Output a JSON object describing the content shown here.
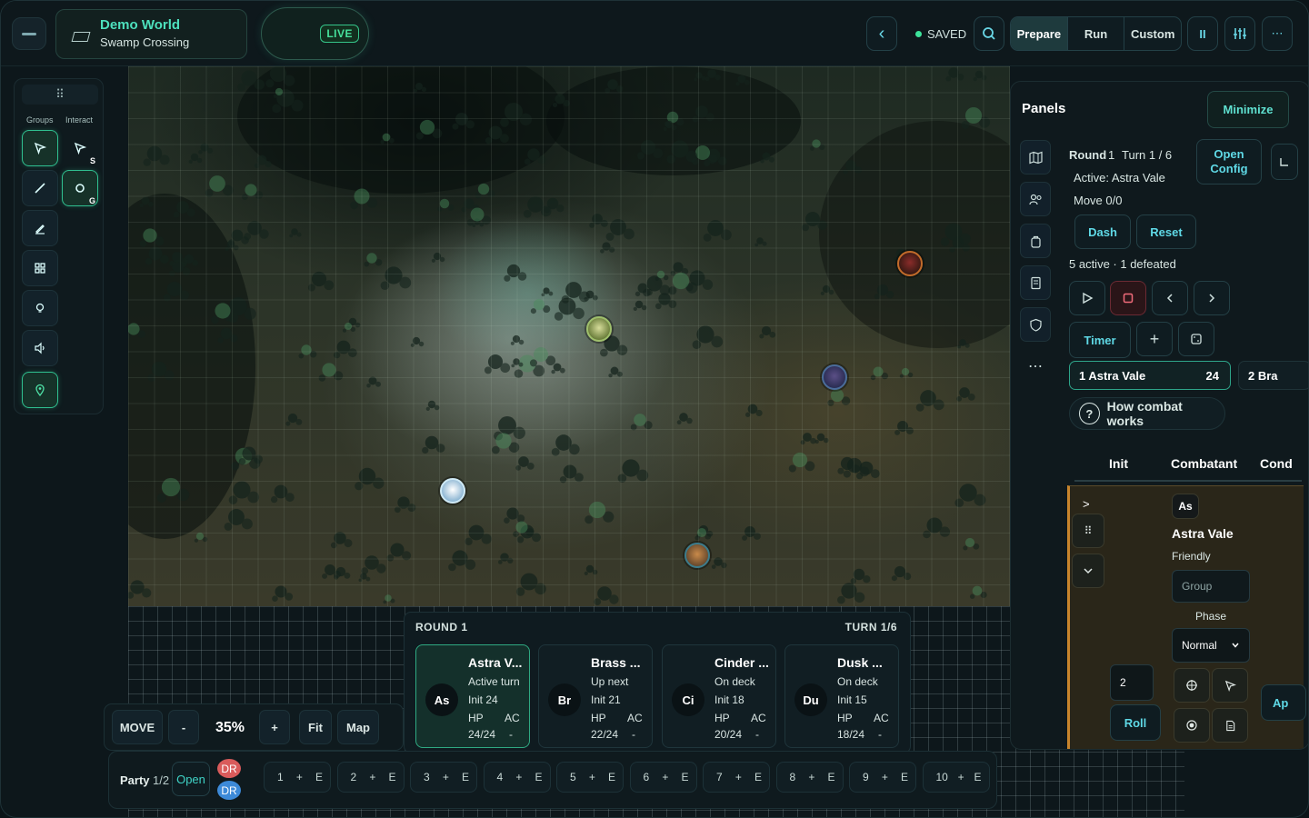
{
  "world": {
    "title": "Demo World",
    "subtitle": "Swamp Crossing"
  },
  "live": "LIVE",
  "status": {
    "saved": "SAVED"
  },
  "modes": {
    "prepare": "Prepare",
    "run": "Run",
    "custom": "Custom"
  },
  "toolbar_glyphs": {
    "back": "‹",
    "pause": "II",
    "more": "⋯"
  },
  "tools": {
    "grip": "⠿",
    "groups": "Groups",
    "interact": "Interact",
    "key_s": "S",
    "key_g": "G"
  },
  "tracker": {
    "round": "ROUND 1",
    "turn": "TURN 1/6",
    "hp_label": "HP",
    "ac_label": "AC",
    "cards": [
      {
        "abbr": "As",
        "name": "Astra V...",
        "status": "Active turn",
        "init": "Init 24",
        "hp": "24/24",
        "ac": "-"
      },
      {
        "abbr": "Br",
        "name": "Brass ...",
        "status": "Up next",
        "init": "Init 21",
        "hp": "22/24",
        "ac": "-"
      },
      {
        "abbr": "Ci",
        "name": "Cinder ...",
        "status": "On deck",
        "init": "Init 18",
        "hp": "20/24",
        "ac": "-"
      },
      {
        "abbr": "Du",
        "name": "Dusk ...",
        "status": "On deck",
        "init": "Init 15",
        "hp": "18/24",
        "ac": "-"
      }
    ]
  },
  "zoom": {
    "move": "MOVE",
    "minus": "-",
    "value": "35%",
    "plus": "+",
    "fit": "Fit",
    "map": "Map"
  },
  "party": {
    "label": "Party",
    "count": "1/2",
    "open": "Open",
    "dr_a": "DR",
    "dr_b": "DR",
    "slot_add": "+",
    "slot_e": "E",
    "slots": [
      "1",
      "2",
      "3",
      "4",
      "5",
      "6",
      "7",
      "8",
      "9",
      "10"
    ]
  },
  "panel": {
    "title": "Panels",
    "minimize": "Minimize",
    "round_label": "Round",
    "round_value": "1",
    "turn": "Turn 1 / 6",
    "active": "Active: Astra Vale",
    "move": "Move 0/0",
    "open_config": "Open Config",
    "dash": "Dash",
    "reset": "Reset",
    "summary": "5 active · 1 defeated",
    "timer": "Timer",
    "plus": "+",
    "chip1_name": "1  Astra Vale",
    "chip1_init": "24",
    "chip2_name": "2  Bra",
    "help": "How combat works",
    "col_init": "Init",
    "col_combatant": "Combatant",
    "col_cond": "Cond",
    "row": {
      "chevron": ">",
      "abbr": "As",
      "name": "Astra Vale",
      "disposition": "Friendly",
      "group_placeholder": "Group",
      "phase_label": "Phase",
      "phase_value": "Normal",
      "init_value": "2",
      "roll": "Roll",
      "ap": "Ap"
    }
  }
}
